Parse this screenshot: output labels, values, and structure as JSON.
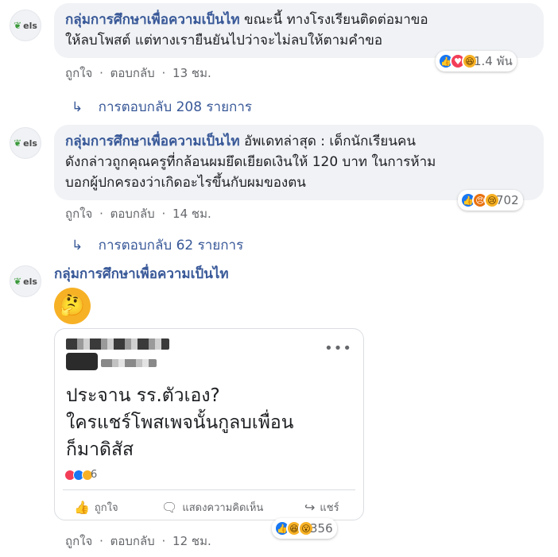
{
  "comments": [
    {
      "author": "กลุ่มการศึกษาเพื่อความเป็นไท",
      "text_line1": "ขณะนี้ ทางโรงเรียนติดต่อมาขอ",
      "text_line2": "ให้ลบโพสต์ แต่ทางเรายืนยันไปว่าจะไม่ลบให้ตามคำขอ",
      "reaction_count": "1.4 พัน",
      "like_label": "ถูกใจ",
      "reply_label": "ตอบกลับ",
      "time": "13 ชม.",
      "replies_text": "การตอบกลับ 208 รายการ"
    },
    {
      "author": "กลุ่มการศึกษาเพื่อความเป็นไท",
      "text_line1": "อัพเดทล่าสุด : เด็กนักเรียนคน",
      "text_line2": "ดังกล่าวถูกคุณครูที่กล้อนผมยึดเยียดเงินให้ 120 บาท ในการห้าม",
      "text_line3": "บอกผู้ปกครองว่าเกิดอะไรขึ้นกับผมของตน",
      "reaction_count": "702",
      "like_label": "ถูกใจ",
      "reply_label": "ตอบกลับ",
      "time": "14 ชม.",
      "replies_text": "การตอบกลับ 62 รายการ"
    },
    {
      "author": "กลุ่มการศึกษาเพื่อความเป็นไท",
      "reaction_count": "356",
      "like_label": "ถูกใจ",
      "reply_label": "ตอบกลับ",
      "time": "12 ชม."
    }
  ],
  "avatar": {
    "brand": "els",
    "leaf": "❦"
  },
  "separator": "·",
  "reply_arrow": "↳",
  "emoji_thinking": "🤔",
  "embedded_post": {
    "more": "•••",
    "line1": "ประจาน รร.ตัวเอง?",
    "line2": "ใครแชร์โพสเพจนั้นกูลบเพื่อน",
    "line3": "ก็มาดิสัส",
    "reaction_count": "6",
    "like_label": "ถูกใจ",
    "comment_label": "แสดงความคิดเห็น",
    "share_label": "แชร์"
  },
  "colors": {
    "link": "#385898",
    "like": "#1877f2",
    "love": "#f33e58",
    "haha": "#f7b125",
    "angry": "#e9710f",
    "bubble": "#f0f2f5"
  }
}
